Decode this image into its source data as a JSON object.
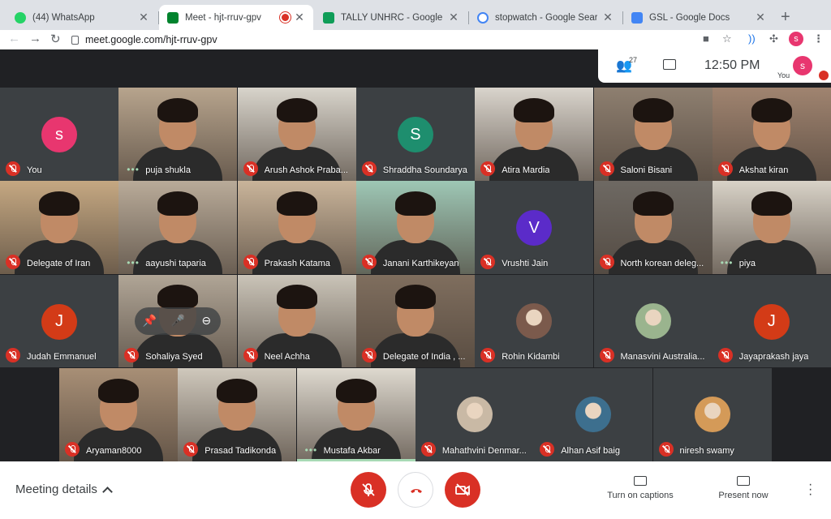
{
  "browser": {
    "tabs": [
      {
        "title": "(44) WhatsApp",
        "favicon_color": "#25d366",
        "badge": "44"
      },
      {
        "title": "Meet - hjt-rruv-gpv",
        "favicon_color": "#00832d",
        "active": true
      },
      {
        "title": "TALLY UNHRC - Google Sheets",
        "favicon_color": "#0f9d58"
      },
      {
        "title": "stopwatch - Google Search",
        "favicon_color": "#4285f4"
      },
      {
        "title": "GSL - Google Docs",
        "favicon_color": "#4285f4"
      }
    ],
    "url": "meet.google.com/hjt-rruv-gpv",
    "profile_initial": "s"
  },
  "header": {
    "participant_count": "27",
    "time": "12:50 PM",
    "self_initial": "s",
    "self_label": "You"
  },
  "participants": [
    {
      "name": "You",
      "kind": "avatar",
      "initial": "s",
      "color": "#e8366f",
      "muted": true
    },
    {
      "name": "puja shukla",
      "kind": "video",
      "bg": "#b7a48d",
      "speaking": true
    },
    {
      "name": "Arush Ashok Praba...",
      "kind": "video",
      "bg": "#d8d4cb",
      "muted": true
    },
    {
      "name": "Shraddha Soundarya",
      "kind": "avatar",
      "initial": "S",
      "color": "#1e8e6e",
      "muted": true
    },
    {
      "name": "Atira Mardia",
      "kind": "video",
      "bg": "#d9d4cc",
      "muted": true
    },
    {
      "name": "Saloni Bisani",
      "kind": "video",
      "bg": "#8e7f70",
      "muted": true
    },
    {
      "name": "Akshat kiran",
      "kind": "video",
      "bg": "#a08470",
      "muted": true
    },
    {
      "name": "Delegate of Iran",
      "kind": "video",
      "bg": "#c5a882",
      "muted": true
    },
    {
      "name": "aayushi taparia",
      "kind": "video",
      "bg": "#b9ab99",
      "speaking": true
    },
    {
      "name": "Prakash Katama",
      "kind": "video",
      "bg": "#c9b49a",
      "muted": true
    },
    {
      "name": "Janani Karthikeyan",
      "kind": "video",
      "bg": "#9ec7b5",
      "muted": true
    },
    {
      "name": "Vrushti Jain",
      "kind": "avatar",
      "initial": "V",
      "color": "#5b2bc9",
      "muted": true
    },
    {
      "name": "North korean deleg...",
      "kind": "video",
      "bg": "#6e6963",
      "muted": true
    },
    {
      "name": "piya",
      "kind": "video",
      "bg": "#d8d2c7",
      "speaking": true
    },
    {
      "name": "Judah Emmanuel",
      "kind": "avatar",
      "initial": "J",
      "color": "#d33b17",
      "muted": true
    },
    {
      "name": "Sohaliya Syed",
      "kind": "video",
      "bg": "#b0a596",
      "muted": true,
      "hover": true
    },
    {
      "name": "Neel Achha",
      "kind": "video",
      "bg": "#cac4b8",
      "muted": true
    },
    {
      "name": "Delegate of India , ...",
      "kind": "video",
      "bg": "#7f6e5e",
      "muted": true
    },
    {
      "name": "Rohin Kidambi",
      "kind": "photo",
      "bg": "#7b5a4c",
      "muted": true
    },
    {
      "name": "Manasvini Australia...",
      "kind": "photo",
      "bg": "#9ab48e",
      "muted": true
    },
    {
      "name": "Jayaprakash jaya",
      "kind": "avatar",
      "initial": "J",
      "color": "#d33b17",
      "muted": true
    },
    {
      "name": "Aryaman8000",
      "kind": "video",
      "bg": "#a88f76",
      "muted": true
    },
    {
      "name": "Prasad Tadikonda",
      "kind": "video",
      "bg": "#cfc8bc",
      "muted": true
    },
    {
      "name": "Mustafa Akbar",
      "kind": "video",
      "bg": "#ded9cf",
      "speaking": true,
      "active_speaker": true
    },
    {
      "name": "Mahathvini Denmar...",
      "kind": "photo",
      "bg": "#c9b9a5",
      "muted": true
    },
    {
      "name": "Alhan Asif baig",
      "kind": "photo",
      "bg": "#3d6f8e",
      "muted": true
    },
    {
      "name": "niresh swamy",
      "kind": "photo",
      "bg": "#d49a58",
      "muted": true
    }
  ],
  "bottom_bar": {
    "details_label": "Meeting details",
    "captions_label": "Turn on captions",
    "present_label": "Present now",
    "end_call_color": "#d93025"
  }
}
